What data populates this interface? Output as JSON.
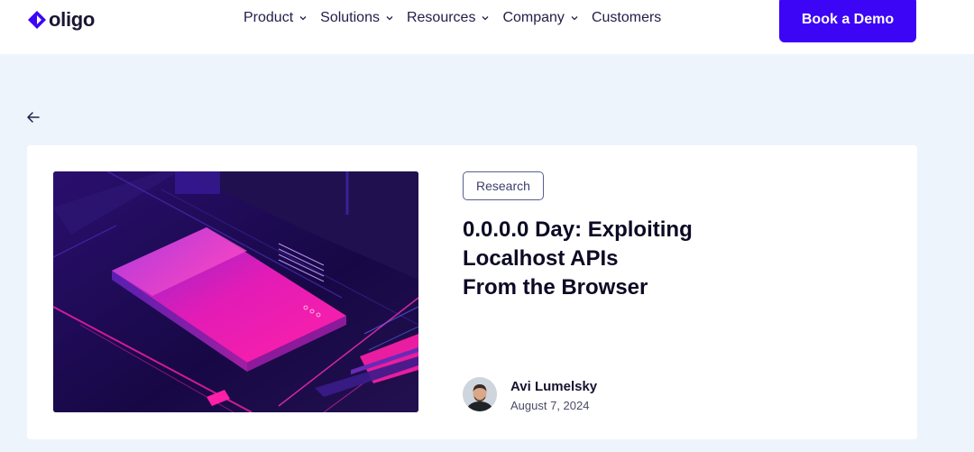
{
  "header": {
    "logo_text": "oligo",
    "nav": [
      {
        "label": "Product",
        "has_dropdown": true
      },
      {
        "label": "Solutions",
        "has_dropdown": true
      },
      {
        "label": "Resources",
        "has_dropdown": true
      },
      {
        "label": "Company",
        "has_dropdown": true
      },
      {
        "label": "Customers",
        "has_dropdown": false
      }
    ],
    "cta_label": "Book a Demo"
  },
  "back": {
    "icon": "arrow-left-icon"
  },
  "article": {
    "tag": "Research",
    "title_lines": [
      "0.0.0.0 Day: Exploiting",
      "Localhost APIs",
      "From the Browser"
    ],
    "author": {
      "name": "Avi Lumelsky",
      "date": "August 7, 2024"
    }
  },
  "colors": {
    "accent": "#3c05f5",
    "page_bg": "#eef4fc",
    "card_bg": "#ffffff",
    "hero_magenta": "#ff19b4",
    "hero_navy": "#1b0b4a"
  }
}
